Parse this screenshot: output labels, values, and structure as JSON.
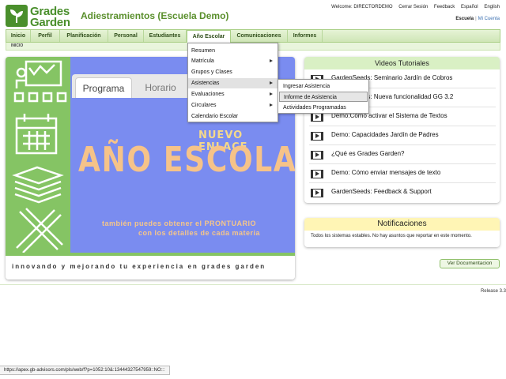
{
  "header": {
    "logo_line1": "Grades",
    "logo_line2": "Garden",
    "title": "Adiestramientos (Escuela Demo)",
    "top_links": [
      "Welcome: DIRECTORDEMO",
      "Cerrar Sesión",
      "Feedback",
      "Español",
      "English"
    ],
    "school_label": "Escuela",
    "account_label": "Mi Cuenta"
  },
  "nav": {
    "items": [
      "Inicio",
      "Perfil",
      "Planificación",
      "Personal",
      "Estudiantes",
      "Año Escolar",
      "Comunicaciones",
      "Informes"
    ],
    "active": "Año Escolar"
  },
  "breadcrumb": "INICIO",
  "dropdown": {
    "items": [
      {
        "label": "Resumen",
        "submenu": false
      },
      {
        "label": "Matrícula",
        "submenu": true
      },
      {
        "label": "Grupos y Clases",
        "submenu": false
      },
      {
        "label": "Asistencias",
        "submenu": true
      },
      {
        "label": "Evaluaciones",
        "submenu": true
      },
      {
        "label": "Circulares",
        "submenu": true
      },
      {
        "label": "Calendario Escolar",
        "submenu": false
      }
    ],
    "highlighted": "Asistencias"
  },
  "submenu": {
    "items": [
      "Ingresar Asistencia",
      "Informe de Asistencia",
      "Actividades Programadas"
    ],
    "highlighted": "Informe de Asistencia"
  },
  "banner": {
    "tab_active": "Programa",
    "tab_second": "Horario",
    "nuevo": "NUEVO ENLACE",
    "big_title": "AÑO ESCOLAR",
    "line1": "también puedes obtener el PRONTUARIO",
    "line2": "con los detalles de cada materia",
    "footer": "innovando y mejorando tu experiencia en grades garden"
  },
  "videos": {
    "title": "Videos Tutoriales",
    "items": [
      "GardenSeeds: Seminario Jardín de Cobros",
      "GardenSeeds: Nueva funcionalidad GG 3.2",
      "Demo:Como activar el Sistema de Textos",
      "Demo: Capacidades Jardín de Padres",
      "¿Qué es Grades Garden?",
      "Demo: Cómo enviar mensajes de texto",
      "GardenSeeds: Feedback & Support"
    ]
  },
  "notifications": {
    "title": "Notificaciones",
    "message": "Todos los sistemas estables. No hay asuntos que reportar en este momento."
  },
  "doc_button": "Ver Documentacion",
  "release": "Release 3.3",
  "status_url": "https://apex.gb-advisors.com/pls/web/f?p=1052:10&:13444327547959::NO:::",
  "colors": {
    "brand_green": "#4a8f2c",
    "banner_green": "#85c464",
    "banner_blue": "#7a8cf0",
    "banner_orange": "#f6c389"
  }
}
